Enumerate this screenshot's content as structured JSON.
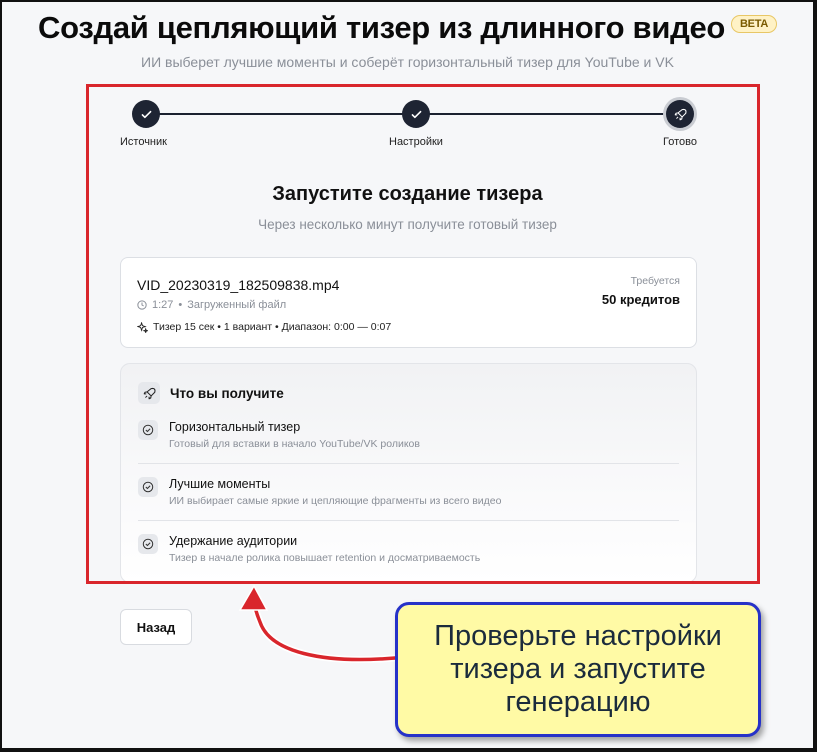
{
  "header": {
    "title": "Создай цепляющий тизер из длинного видео",
    "badge": "BETA",
    "subtitle": "ИИ выберет лучшие моменты и соберёт горизонтальный тизер для YouTube и VK"
  },
  "stepper": {
    "steps": [
      {
        "label": "Источник",
        "state": "done",
        "icon": "check-icon"
      },
      {
        "label": "Настройки",
        "state": "done",
        "icon": "check-icon"
      },
      {
        "label": "Готово",
        "state": "current",
        "icon": "rocket-icon"
      }
    ]
  },
  "launch": {
    "heading": "Запустите создание тизера",
    "subheading": "Через несколько минут получите готовый тизер"
  },
  "file_card": {
    "file_name": "VID_20230319_182509838.mp4",
    "duration": "1:27",
    "source": "Загруженный файл",
    "settings": "Тизер 15 сек • 1 вариант • Диапазон: 0:00 — 0:07",
    "required_label": "Требуется",
    "required_value": "50 кредитов"
  },
  "benefits": {
    "heading": "Что вы получите",
    "items": [
      {
        "title": "Горизонтальный тизер",
        "description": "Готовый для вставки в начало YouTube/VK роликов"
      },
      {
        "title": "Лучшие моменты",
        "description": "ИИ выбирает самые яркие и цепляющие фрагменты из всего видео"
      },
      {
        "title": "Удержание аудитории",
        "description": "Тизер в начале ролика повышает retention и досматриваемость"
      }
    ]
  },
  "nav": {
    "back_label": "Назад"
  },
  "annotation": {
    "callout_text": "Проверьте настройки тизера и запустите генерацию",
    "highlight_color": "#d9262c",
    "callout_border_color": "#2632c8",
    "callout_fill_color": "#fffaa5"
  }
}
